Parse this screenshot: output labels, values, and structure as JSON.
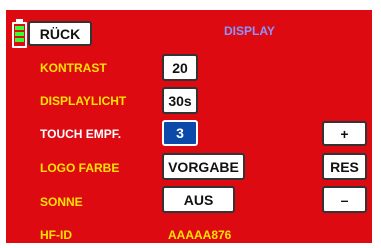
{
  "colors": {
    "screen_background": "#dd0a12",
    "label": "#ffe200",
    "label_selected": "#ffffff",
    "title": "#8b93ff",
    "active_value": "#0b4aa8",
    "battery_fill": "#33ff33"
  },
  "header": {
    "battery_icon": "battery-icon",
    "back_label": "RÜCK",
    "title": "DISPLAY"
  },
  "rows": [
    {
      "label": "KONTRAST",
      "value": "20"
    },
    {
      "label": "DISPLAYLICHT",
      "value": "30s"
    },
    {
      "label": "TOUCH EMPF.",
      "value": "3",
      "active": true
    },
    {
      "label": "LOGO FARBE",
      "value": "VORGABE"
    },
    {
      "label": "SONNE",
      "value": "AUS"
    },
    {
      "label": "HF-ID",
      "value": "AAAAA876"
    }
  ],
  "side_buttons": {
    "plus": "+",
    "reset": "RES",
    "minus": "–"
  }
}
